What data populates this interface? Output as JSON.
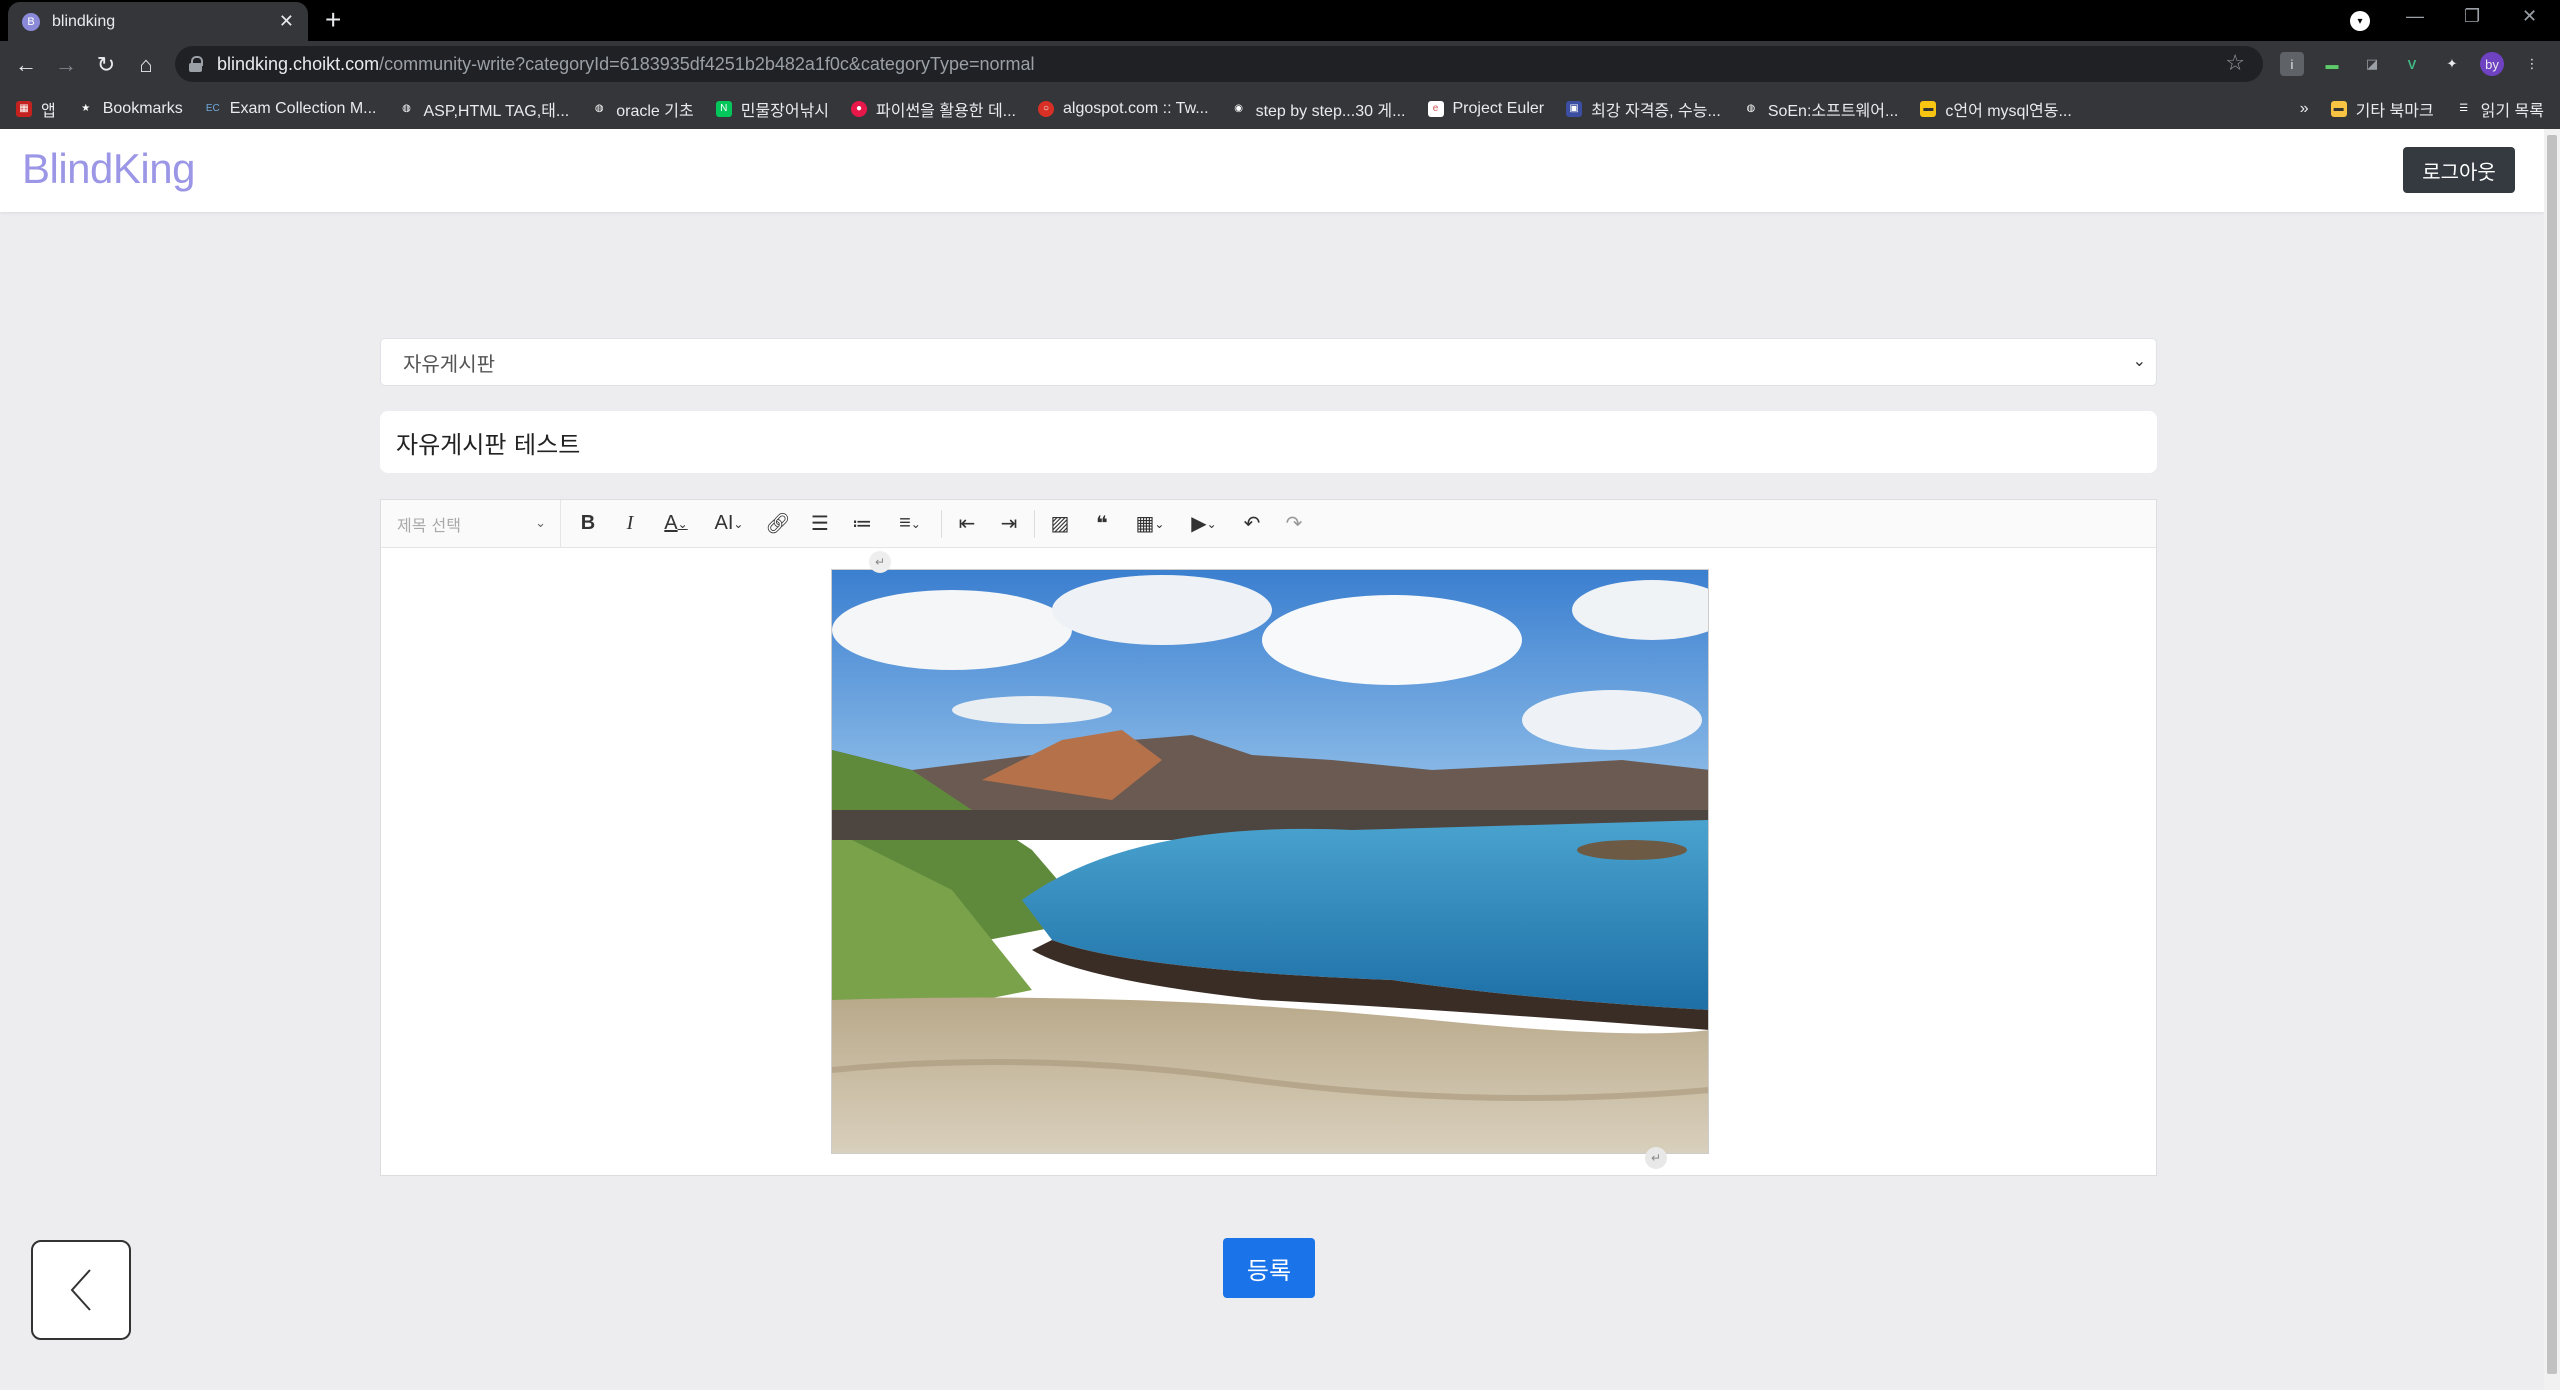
{
  "browser": {
    "tab_title": "blindking",
    "favicon_letter": "B",
    "url_host": "blindking.choikt.com",
    "url_path": "/community-write?categoryId=6183935df4251b2b482a1f0c&categoryType=normal",
    "profile_initials": "by"
  },
  "bookmarks": {
    "items": [
      {
        "label": "앱"
      },
      {
        "label": "Bookmarks"
      },
      {
        "label": "Exam Collection M..."
      },
      {
        "label": "ASP,HTML TAG,태..."
      },
      {
        "label": "oracle 기초"
      },
      {
        "label": "민물장어낚시"
      },
      {
        "label": "파이썬을 활용한 데..."
      },
      {
        "label": "algospot.com :: Tw..."
      },
      {
        "label": "step by step...30 게..."
      },
      {
        "label": "Project Euler"
      },
      {
        "label": "최강 자격증, 수능..."
      },
      {
        "label": "SoEn:소프트웨어..."
      },
      {
        "label": "c언어 mysql연동..."
      }
    ],
    "overflow": "»",
    "other_folder": "기타 북마크",
    "reading_list": "읽기 목록"
  },
  "site": {
    "logo": "BlindKing",
    "logout_label": "로그아웃"
  },
  "form": {
    "category_selected": "자유게시판",
    "title_value": "자유게시판 테스트",
    "heading_select": "제목 선택",
    "submit_label": "등록"
  },
  "colors": {
    "logo": "#9b96e6",
    "submit": "#1a73e8",
    "logout_bg": "#343a40"
  }
}
